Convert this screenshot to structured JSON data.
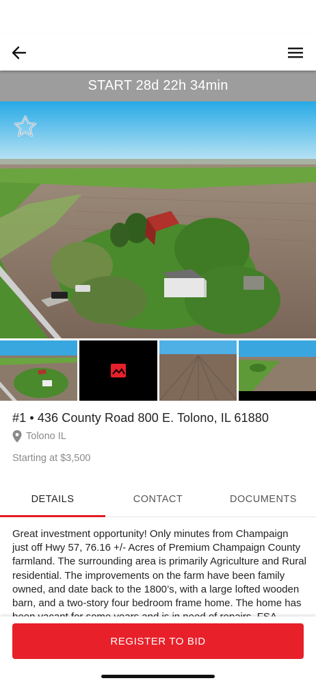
{
  "header": {
    "back_icon": "arrow-left-icon",
    "menu_icon": "hamburger-menu-icon"
  },
  "countdown": {
    "text": "START 28d 22h 34min"
  },
  "hero": {
    "favorite_icon": "star-outline-icon"
  },
  "listing": {
    "title": "#1 • 436 County Road 800 E. Tolono, IL 61880",
    "location": "Tolono IL",
    "price": "Starting at $3,500"
  },
  "tabs": [
    {
      "label": "DETAILS",
      "active": true
    },
    {
      "label": "CONTACT",
      "active": false
    },
    {
      "label": "DOCUMENTS",
      "active": false
    }
  ],
  "details": {
    "description": "Great investment opportunity! Only minutes from Champaign just off Hwy 57, 76.16 +/- Acres of Premium Champaign County farmland. The surrounding area is primarily Agriculture and Rural residential. The improvements on the farm have been family owned, and date back to the 1800’s, with a large lofted wooden barn, and a two-story four bedroom frame home. The home has been vacant for some years and is in need of repairs. FSA record"
  },
  "actions": {
    "register_label": "REGISTER TO BID"
  },
  "colors": {
    "accent": "#e8202a",
    "countdown_bg": "#9d9d9d",
    "muted_text": "#8a8a8a"
  }
}
